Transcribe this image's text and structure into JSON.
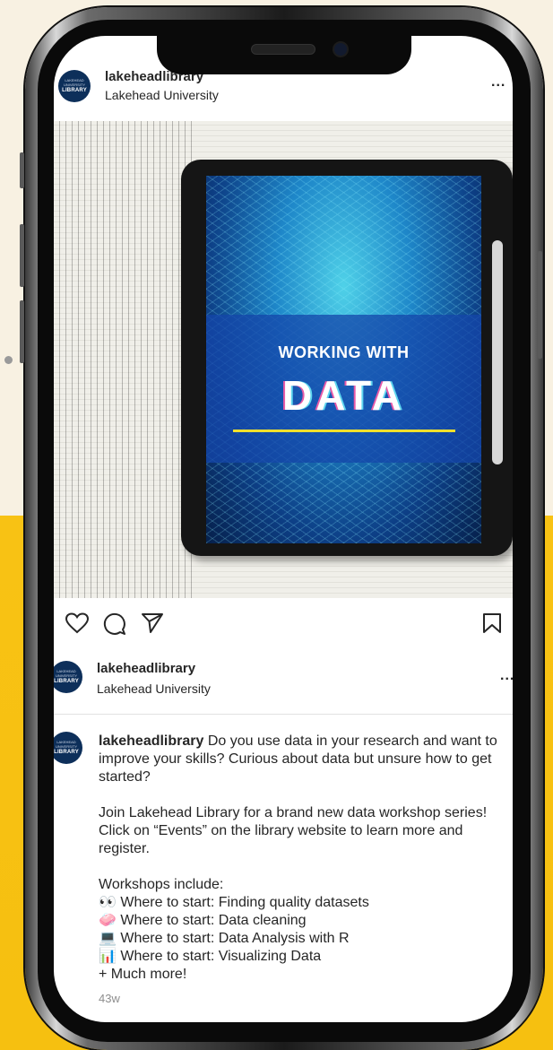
{
  "header": {
    "username": "lakeheadlibrary",
    "subtitle": "Lakehead University",
    "more_glyph": "..."
  },
  "avatar": {
    "line1": "LAKEHEAD",
    "line2": "UNIVERSITY",
    "line3": "LIBRARY"
  },
  "image": {
    "title_small": "WORKING WITH",
    "title_big": "DATA"
  },
  "actions": {
    "like_icon": "heart-icon",
    "comment_icon": "comment-icon",
    "share_icon": "send-icon",
    "save_icon": "bookmark-icon"
  },
  "author": {
    "username": "lakeheadlibrary",
    "subtitle": "Lakehead University"
  },
  "caption": {
    "username": "lakeheadlibrary",
    "para1": "Do you use data in your research and want to improve your skills? Curious about data but unsure how to get started?",
    "para2": "Join Lakehead Library for a brand new data workshop series! Click on “Events” on the library website to learn more and register.",
    "workshops_heading": "Workshops include:",
    "workshops": [
      "👀 Where to start: Finding quality datasets",
      "🧼 Where to start: Data cleaning",
      "💻 Where to start: Data Analysis with R",
      "📊 Where to start: Visualizing Data"
    ],
    "more": "+ Much more!"
  },
  "timestamp": "43w"
}
